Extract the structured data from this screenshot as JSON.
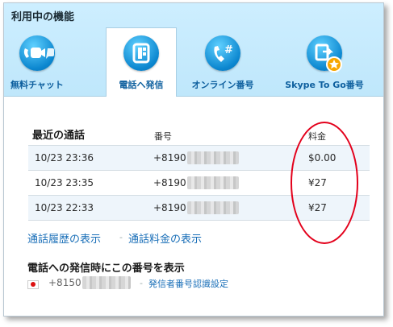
{
  "header": {
    "title": "利用中の機能"
  },
  "tabs": [
    {
      "label": "無料チャット",
      "icon": "chat-call-video-icon",
      "active": false
    },
    {
      "label": "電話へ発信",
      "icon": "phone-dialpad-icon",
      "active": true
    },
    {
      "label": "オンライン番号",
      "icon": "online-number-icon",
      "active": false
    },
    {
      "label": "Skype To Go番号",
      "icon": "skype-to-go-icon",
      "active": false
    }
  ],
  "recent_calls": {
    "heading": "最近の通話",
    "col_number": "番号",
    "col_fee": "料金",
    "rows": [
      {
        "datetime": "10/23 23:36",
        "number": "+8190",
        "fee": "$0.00"
      },
      {
        "datetime": "10/23 23:35",
        "number": "+8190",
        "fee": "¥27"
      },
      {
        "datetime": "10/23 22:33",
        "number": "+8190",
        "fee": "¥27"
      }
    ]
  },
  "links": {
    "history": "通話履歴の表示",
    "rates": "通話料金の表示",
    "separator": "-"
  },
  "caller_id": {
    "heading": "電話への発信時にこの番号を表示",
    "number": "+8150",
    "separator": "-",
    "settings_link": "発信者番号認識設定"
  },
  "colors": {
    "accent": "#0b86cf",
    "link": "#1a6fb8",
    "highlight_oval": "#e3001b",
    "header_bg": "#c6eafd"
  }
}
